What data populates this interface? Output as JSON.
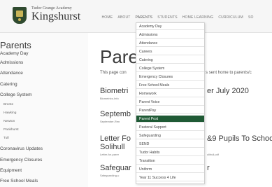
{
  "header": {
    "school_small": "Tudor Grange Academy",
    "school_name": "Kingshurst",
    "nav": [
      "HOME",
      "ABOUT",
      "PARENTS",
      "STUDENTS",
      "HOME LEARNING",
      "CURRICULUM",
      "SO"
    ]
  },
  "sidebar": {
    "title": "Parents",
    "items": [
      "Academy Day",
      "Admissions",
      "Attendance",
      "Catering",
      "College System"
    ],
    "sub_items": [
      "Bronte",
      "Hawking",
      "Newton",
      "Pankhurst",
      "Tull"
    ],
    "items_after": [
      "Coronavirus Updates",
      "Emergency Closures",
      "Equipment",
      "Free School Meals"
    ]
  },
  "main": {
    "title": "Pare",
    "intro": "This page con",
    "intro_tail": "s sent home to parents/c",
    "articles": [
      {
        "title": "Biometri",
        "title_tail": "er July 2020",
        "meta": "Biometrics-Info",
        "meta_tail": ""
      },
      {
        "title": "Septemb",
        "title_tail": "",
        "meta": "September-Ren",
        "meta_tail": ""
      },
      {
        "title": "Letter Fo",
        "title_tail": "&9 Pupils To Schoo",
        "title2": "Solihull",
        "meta": "Letter-for-parer",
        "meta_tail": "olihull.pdf"
      },
      {
        "title": "Safeguar",
        "title_tail": "r",
        "meta": "Safeguarding-u",
        "meta_tail": ""
      }
    ]
  },
  "dropdown": {
    "items": [
      "Academy Day",
      "Admissions",
      "Attendance",
      "Careers",
      "Catering",
      "College System",
      "Emergency Closures",
      "Free School Meals",
      "Homework",
      "Parent Voice",
      "ParentPay",
      "Parent Post",
      "Pastoral Support",
      "Safeguarding",
      "SEND",
      "Tudor Habits",
      "Transition",
      "Uniform",
      "Year 11 Success 4 Life"
    ],
    "selected": "Parent Post",
    "selected_color": "#1f5a35"
  }
}
